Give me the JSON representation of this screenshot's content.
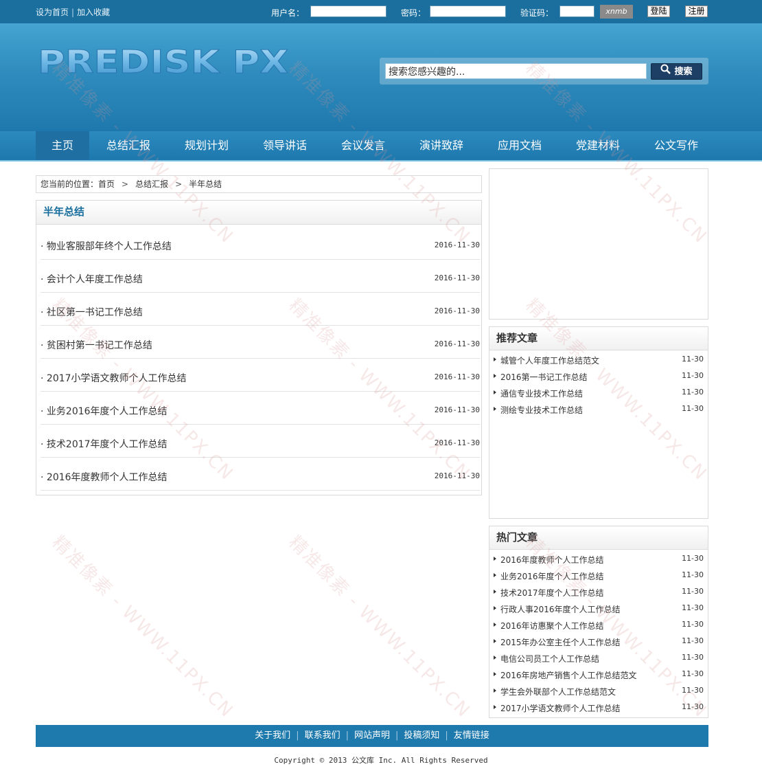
{
  "topbar": {
    "set_home": "设为首页",
    "separator": "|",
    "add_favorite": "加入收藏",
    "username_label": "用户名：",
    "password_label": "密码：",
    "captcha_label": "验证码：",
    "captcha_text": "xnmb",
    "login_button": "登陆",
    "register_button": "注册"
  },
  "header": {
    "logo_text": "PREDISK PX",
    "search_placeholder": "搜索您感兴趣的...",
    "search_button": "搜索"
  },
  "nav": {
    "items": [
      "主页",
      "总结汇报",
      "规划计划",
      "领导讲话",
      "会议发言",
      "演讲致辞",
      "应用文档",
      "党建材料",
      "公文写作"
    ],
    "active_index": 0
  },
  "breadcrumb": {
    "prefix": "您当前的位置：",
    "items": [
      "首页",
      "总结汇报",
      "半年总结"
    ],
    "arrow": ">"
  },
  "list": {
    "title": "半年总结",
    "bullet": "·",
    "articles": [
      {
        "title": "物业客服部年终个人工作总结",
        "date": "2016-11-30"
      },
      {
        "title": "会计个人年度工作总结",
        "date": "2016-11-30"
      },
      {
        "title": "社区第一书记工作总结",
        "date": "2016-11-30"
      },
      {
        "title": "贫困村第一书记工作总结",
        "date": "2016-11-30"
      },
      {
        "title": "2017小学语文教师个人工作总结",
        "date": "2016-11-30"
      },
      {
        "title": "业务2016年度个人工作总结",
        "date": "2016-11-30"
      },
      {
        "title": "技术2017年度个人工作总结",
        "date": "2016-11-30"
      },
      {
        "title": "2016年度教师个人工作总结",
        "date": "2016-11-30"
      }
    ]
  },
  "recommended": {
    "title": "推荐文章",
    "items": [
      {
        "title": "城管个人年度工作总结范文",
        "date": "11-30"
      },
      {
        "title": "2016第一书记工作总结",
        "date": "11-30"
      },
      {
        "title": "通信专业技术工作总结",
        "date": "11-30"
      },
      {
        "title": "测绘专业技术工作总结",
        "date": "11-30"
      }
    ]
  },
  "hot": {
    "title": "热门文章",
    "items": [
      {
        "title": "2016年度教师个人工作总结",
        "date": "11-30"
      },
      {
        "title": "业务2016年度个人工作总结",
        "date": "11-30"
      },
      {
        "title": "技术2017年度个人工作总结",
        "date": "11-30"
      },
      {
        "title": "行政人事2016年度个人工作总结",
        "date": "11-30"
      },
      {
        "title": "2016年访惠聚个人工作总结",
        "date": "11-30"
      },
      {
        "title": "2015年办公室主任个人工作总结",
        "date": "11-30"
      },
      {
        "title": "电信公司员工个人工作总结",
        "date": "11-30"
      },
      {
        "title": "2016年房地产销售个人工作总结范文",
        "date": "11-30"
      },
      {
        "title": "学生会外联部个人工作总结范文",
        "date": "11-30"
      },
      {
        "title": "2017小学语文教师个人工作总结",
        "date": "11-30"
      }
    ]
  },
  "footer": {
    "links": [
      "关于我们",
      "联系我们",
      "网站声明",
      "投稿须知",
      "友情链接"
    ],
    "separator": "|",
    "copyright": "Copyright © 2013 公文库 Inc. All Rights Reserved"
  },
  "watermark": "精准像素 - WWW.11PX.CN",
  "colors": {
    "brand_blue": "#1a6f9e",
    "nav_blue": "#1e79ad",
    "header_light": "#45a4d2"
  }
}
